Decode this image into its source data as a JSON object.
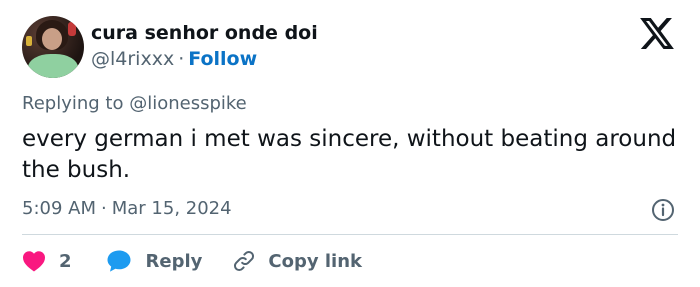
{
  "author": {
    "display_name": "cura senhor onde doi",
    "handle": "@l4rixxx",
    "separator": "·",
    "follow_label": "Follow"
  },
  "reply_context": {
    "prefix": "Replying to",
    "mention": "@lionesspike"
  },
  "tweet": {
    "text": "every german i met was sincere, without beating around the bush.",
    "time": "5:09 AM",
    "separator": "·",
    "date": "Mar 15, 2024"
  },
  "actions": {
    "like_count": "2",
    "reply_label": "Reply",
    "copy_link_label": "Copy link"
  },
  "icons": {
    "logo": "x-logo-icon",
    "info": "info-icon",
    "like": "heart-icon",
    "reply": "speech-bubble-icon",
    "copy": "link-icon"
  },
  "colors": {
    "link_blue": "#0b73c6",
    "heart": "#f91880",
    "reply_bubble": "#1d9bf0",
    "muted_text": "#536471",
    "divider": "#cfd9de"
  }
}
